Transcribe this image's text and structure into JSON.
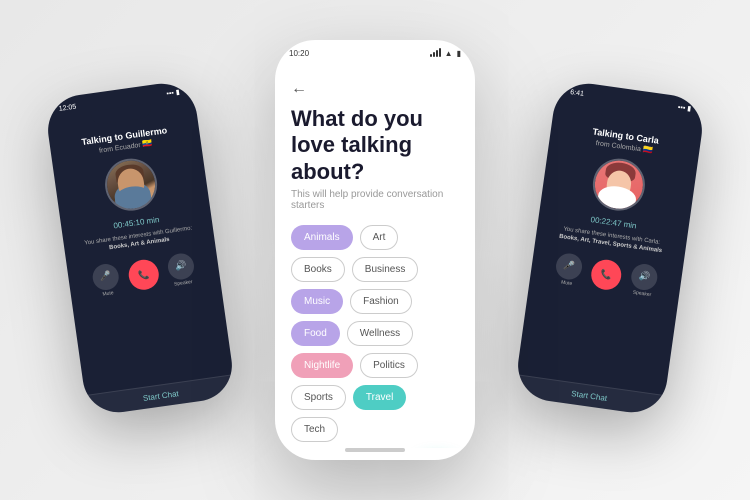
{
  "scene": {
    "background": "#f0f0f0"
  },
  "left_phone": {
    "status_time": "12:05",
    "title": "Talking to Guillermo",
    "from_label": "from Ecuador",
    "flag": "🇪🇨",
    "timer": "00:45:10 min",
    "share_text": "You share these interests with Guillermo:",
    "share_interests": "Books, Art & Animals",
    "mute_label": "Mute",
    "speaker_label": "Speaker",
    "start_chat_label": "Start Chat"
  },
  "right_phone": {
    "status_time": "6:41",
    "title": "Talking to Carla",
    "from_label": "from Colombia",
    "flag": "🇨🇴",
    "timer": "00:22:47 min",
    "share_text": "You share these interests with Carla:",
    "share_interests": "Books, Art, Travel, Sports & Animals",
    "mute_label": "Mute",
    "speaker_label": "Speaker",
    "start_chat_label": "Start Chat"
  },
  "center_phone": {
    "status_time": "10:20",
    "back_arrow": "←",
    "title": "What do you love talking about?",
    "subtitle": "This will help provide conversation starters",
    "tags": [
      {
        "label": "Animals",
        "style": "purple"
      },
      {
        "label": "Art",
        "style": "outline"
      },
      {
        "label": "Books",
        "style": "outline"
      },
      {
        "label": "Business",
        "style": "outline"
      },
      {
        "label": "Music",
        "style": "purple"
      },
      {
        "label": "Fashion",
        "style": "outline"
      },
      {
        "label": "Food",
        "style": "purple"
      },
      {
        "label": "Wellness",
        "style": "outline"
      },
      {
        "label": "Nightlife",
        "style": "pink"
      },
      {
        "label": "Politics",
        "style": "outline"
      },
      {
        "label": "Sports",
        "style": "outline"
      },
      {
        "label": "Travel",
        "style": "teal"
      },
      {
        "label": "Tech",
        "style": "outline"
      }
    ],
    "next_button_icon": "→"
  }
}
